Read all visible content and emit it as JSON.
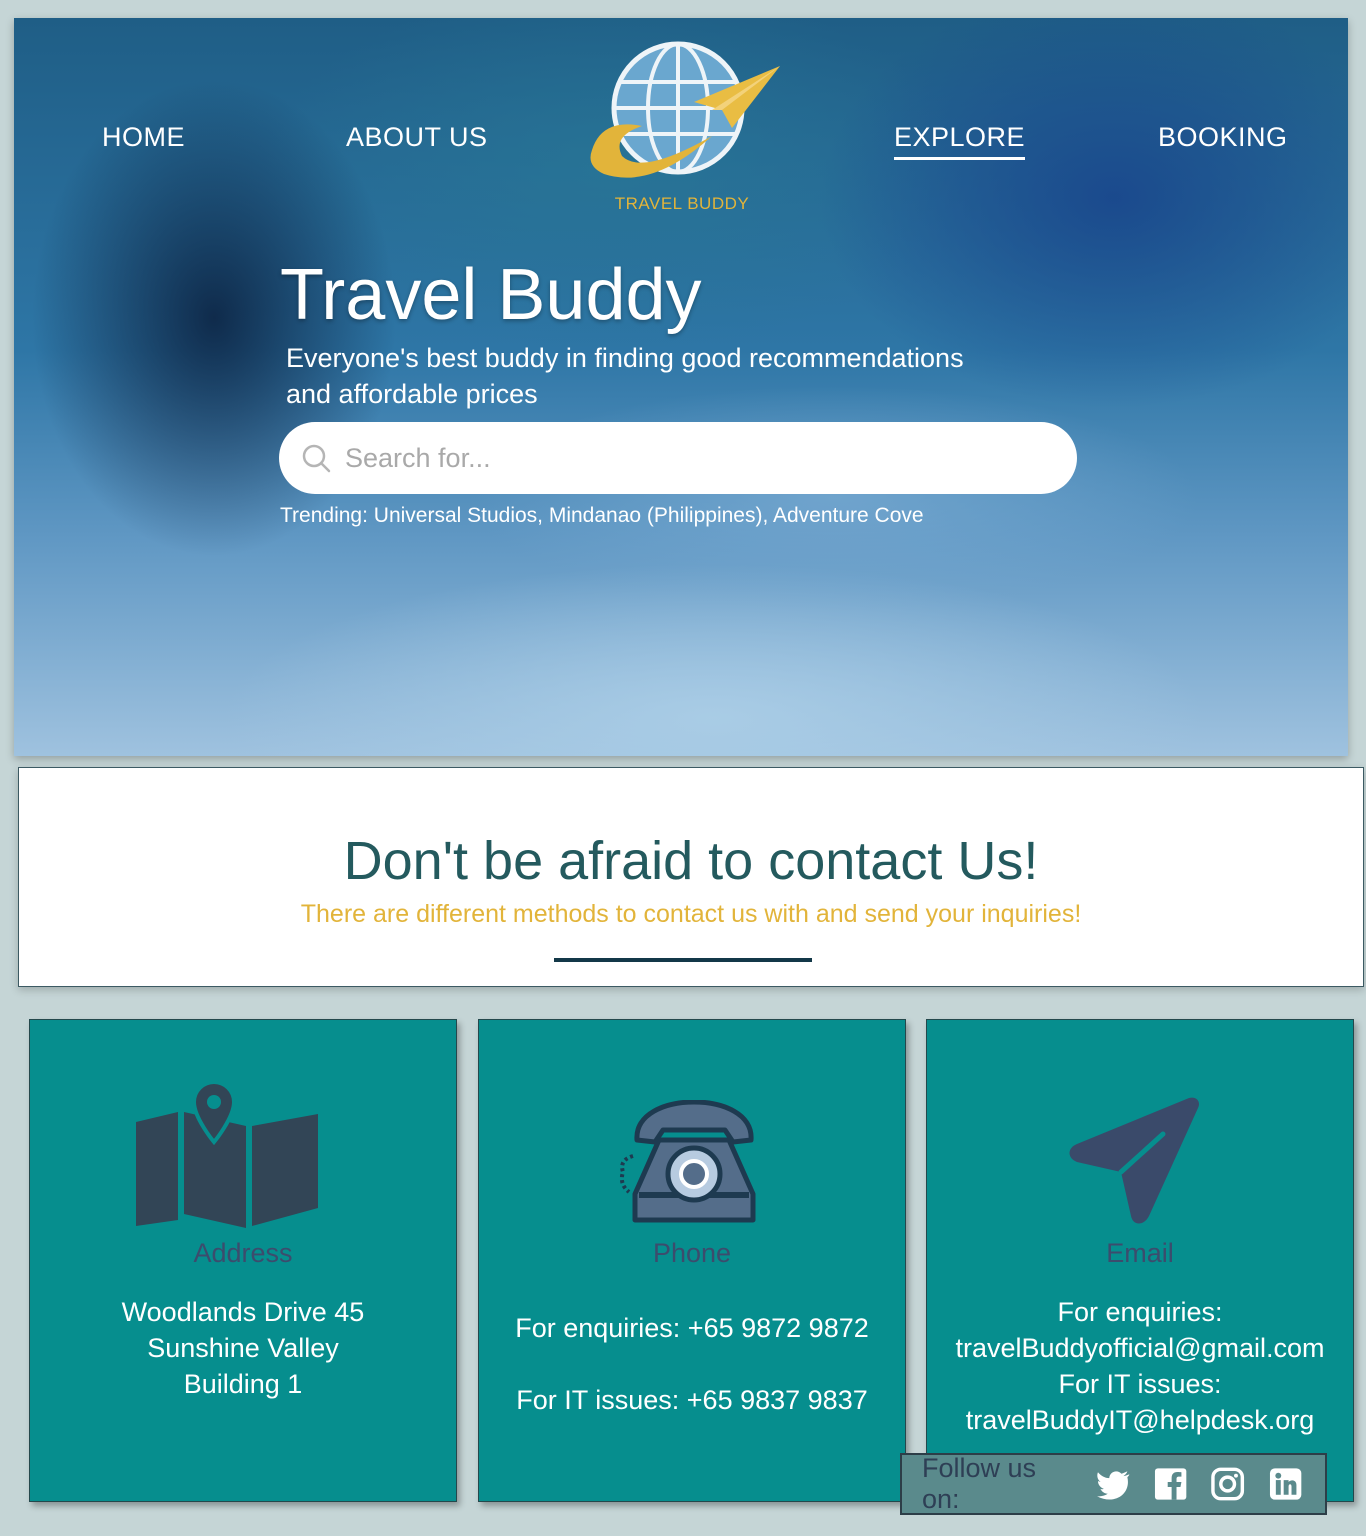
{
  "nav": {
    "home": "HOME",
    "about": "ABOUT US",
    "explore": "EXPLORE",
    "booking": "BOOKING",
    "logo_text": "TRAVEL BUDDY"
  },
  "hero": {
    "title": "Travel Buddy",
    "subtitle_line1": "Everyone's best buddy in finding good recommendations",
    "subtitle_line2": "and affordable prices",
    "search_placeholder": "Search for...",
    "trending": "Trending: Universal Studios, Mindanao (Philippines), Adventure Cove"
  },
  "contact": {
    "title": "Don't be afraid to contact Us!",
    "subtitle": "There are different methods to contact us with and send your inquiries!"
  },
  "cards": {
    "address": {
      "icon": "map-icon",
      "title": "Address",
      "line1": "Woodlands Drive 45",
      "line2": "Sunshine Valley",
      "line3": "Building 1"
    },
    "phone": {
      "icon": "telephone-icon",
      "title": "Phone",
      "line1": "For enquiries: +65 9872 9872",
      "line2": "For IT issues: +65 9837 9837"
    },
    "email": {
      "icon": "send-icon",
      "title": "Email",
      "line1": "For enquiries:",
      "line2": "travelBuddyofficial@gmail.com",
      "line3": "For IT issues:",
      "line4": "travelBuddyIT@helpdesk.org"
    }
  },
  "follow": {
    "label": "Follow us on:",
    "icons": [
      "twitter-icon",
      "facebook-icon",
      "instagram-icon",
      "linkedin-icon"
    ]
  },
  "colors": {
    "teal_card": "#068e8e",
    "gold": "#e2b43a",
    "heading_teal": "#245a5e",
    "page_bg": "#c5d5d6"
  }
}
